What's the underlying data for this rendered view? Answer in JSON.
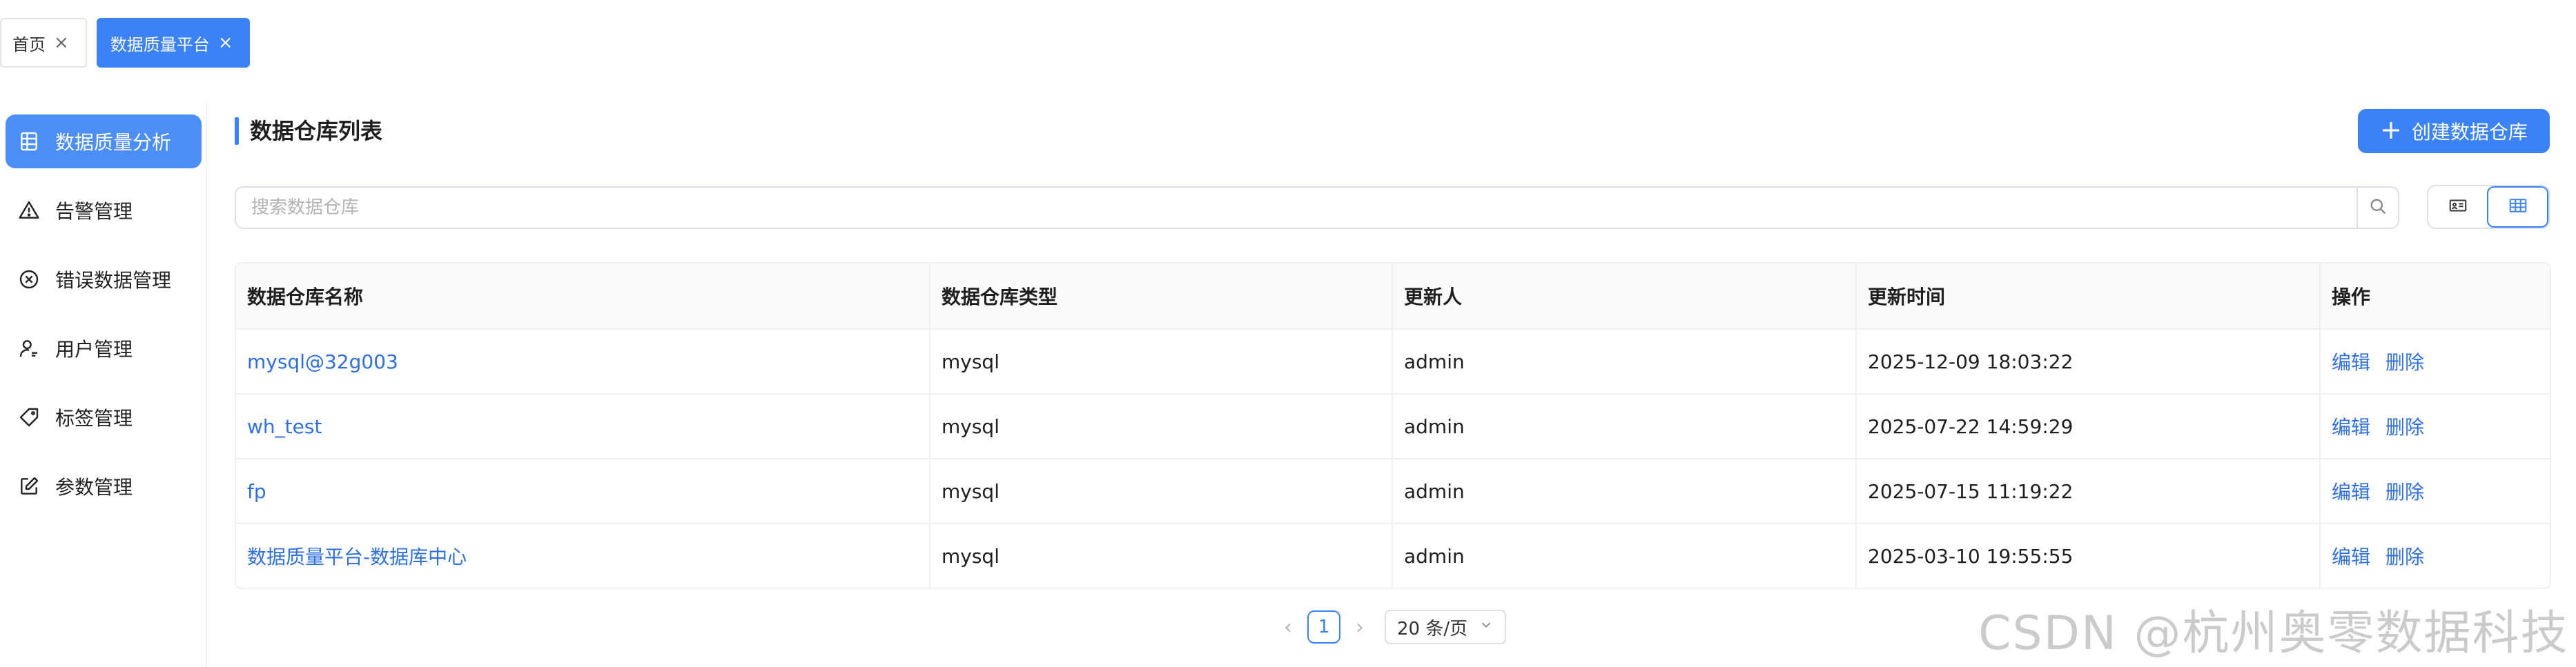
{
  "tabs": [
    {
      "label": "首页",
      "active": false
    },
    {
      "label": "数据质量平台",
      "active": true
    }
  ],
  "sidebar": {
    "items": [
      {
        "label": "数据质量分析",
        "icon": "table-icon",
        "active": true
      },
      {
        "label": "告警管理",
        "icon": "warning-icon",
        "active": false
      },
      {
        "label": "错误数据管理",
        "icon": "close-circle-icon",
        "active": false
      },
      {
        "label": "用户管理",
        "icon": "user-icon",
        "active": false
      },
      {
        "label": "标签管理",
        "icon": "tag-icon",
        "active": false
      },
      {
        "label": "参数管理",
        "icon": "edit-icon",
        "active": false
      }
    ]
  },
  "main": {
    "title": "数据仓库列表",
    "create_button": "创建数据仓库",
    "search_placeholder": "搜索数据仓库",
    "table": {
      "columns": [
        "数据仓库名称",
        "数据仓库类型",
        "更新人",
        "更新时间",
        "操作"
      ],
      "rows": [
        {
          "name": "mysql@32g003",
          "type": "mysql",
          "updater": "admin",
          "time": "2025-12-09 18:03:22"
        },
        {
          "name": "wh_test",
          "type": "mysql",
          "updater": "admin",
          "time": "2025-07-22 14:59:29"
        },
        {
          "name": "fp",
          "type": "mysql",
          "updater": "admin",
          "time": "2025-07-15 11:19:22"
        },
        {
          "name": "数据质量平台-数据库中心",
          "type": "mysql",
          "updater": "admin",
          "time": "2025-03-10 19:55:55"
        }
      ],
      "actions": {
        "edit": "编辑",
        "delete": "删除"
      }
    },
    "pagination": {
      "current_page": "1",
      "page_size": "20 条/页"
    }
  },
  "watermark": "CSDN @杭州奥零数据科技",
  "colors": {
    "accent": "#3b82f6",
    "link": "#2f6fe4"
  }
}
